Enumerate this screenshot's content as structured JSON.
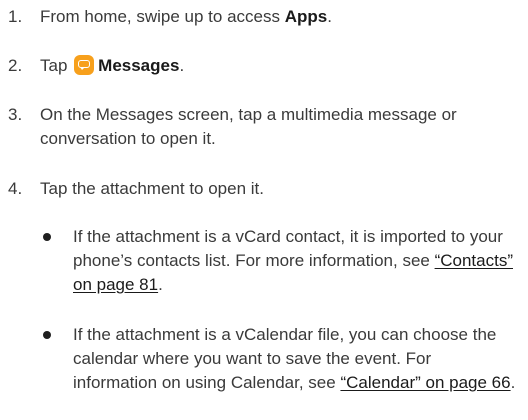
{
  "steps": [
    {
      "number": "1.",
      "prefix": "From home, swipe up to access ",
      "bold": "Apps",
      "suffix": "."
    },
    {
      "number": "2.",
      "prefix": "Tap",
      "icon": "messages-app-icon",
      "bold": "Messages",
      "suffix": "."
    },
    {
      "number": "3.",
      "text": "On the Messages screen, tap a multimedia message or conversation to open it."
    },
    {
      "number": "4.",
      "text": "Tap the attachment to open it."
    }
  ],
  "bullets": [
    {
      "text": "If the attachment is a vCard contact, it is imported to your phone’s contacts list. For more information, see ",
      "link": "“Contacts” on page 81",
      "suffix": "."
    },
    {
      "text": "If the attachment is a vCalendar file, you can choose the calendar where you want to save the event. For information on using Calendar, see ",
      "link": "“Calendar” on page 66",
      "suffix": "."
    }
  ],
  "colors": {
    "text": "#3a3a3a",
    "icon_bg": "#f7a01c"
  }
}
